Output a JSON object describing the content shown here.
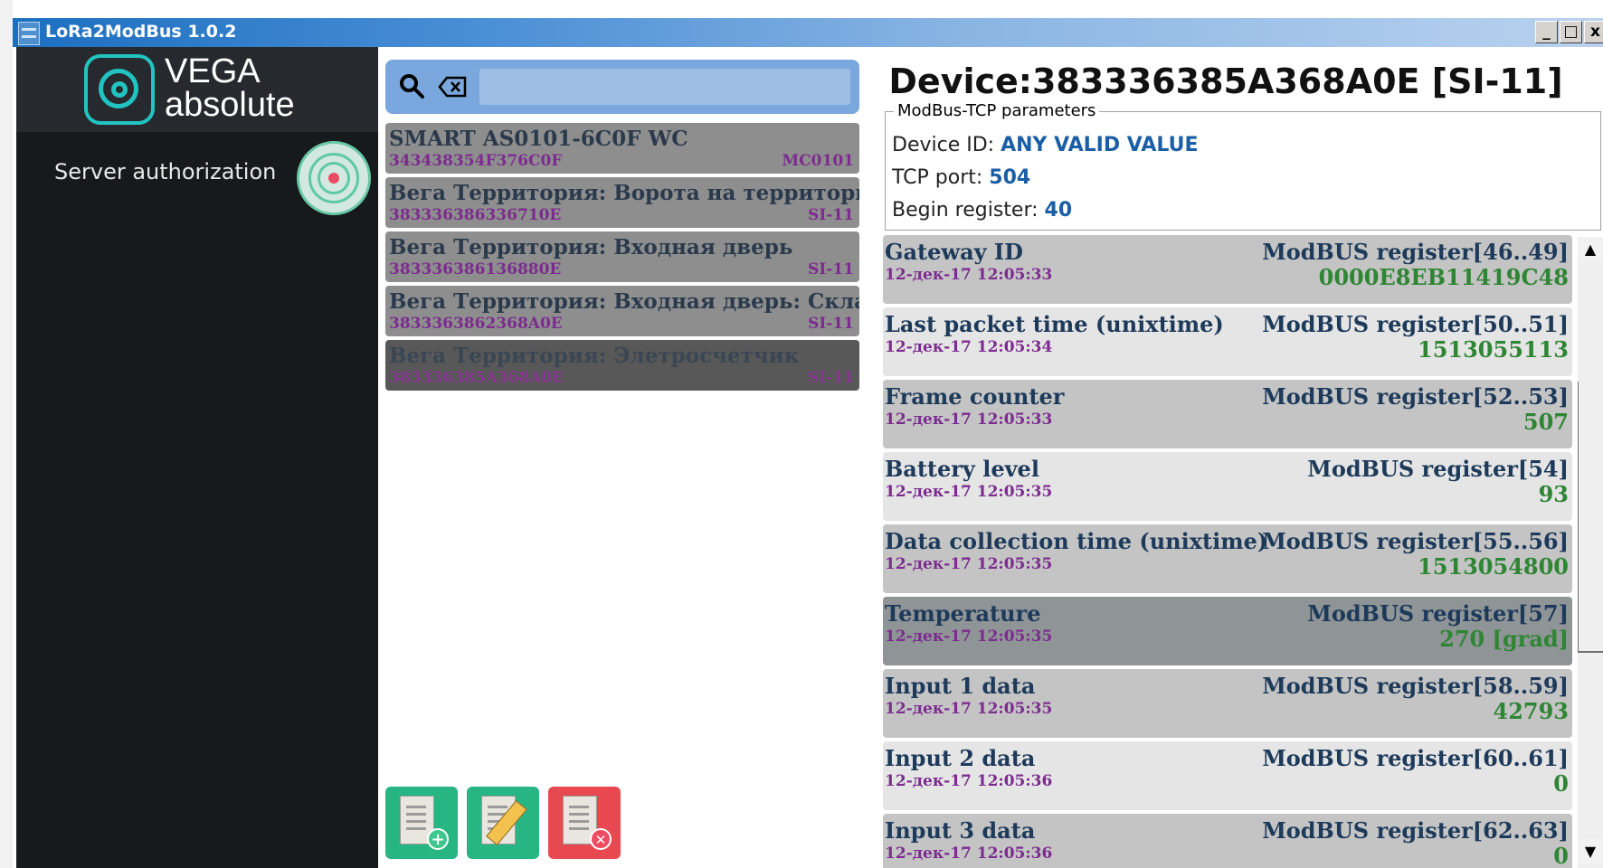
{
  "window": {
    "title": "LoRa2ModBus 1.0.2",
    "minimize": "_",
    "maximize": "□",
    "close": "x"
  },
  "sidebar": {
    "logo_line1": "VEGA",
    "logo_line2": "absolute",
    "items": [
      {
        "label": "Server authorization",
        "icon": "radar-icon"
      }
    ]
  },
  "search": {
    "value": "",
    "placeholder": ""
  },
  "devices": [
    {
      "name": "SMART AS0101-6C0F WC",
      "id": "343438354F376C0F",
      "type": "MC0101"
    },
    {
      "name": "Вега Территория: Ворота на территорию",
      "id": "383336386336710E",
      "type": "SI-11"
    },
    {
      "name": "Вега Территория: Входная дверь",
      "id": "383336386136880E",
      "type": "SI-11"
    },
    {
      "name": "Вега Территория: Входная дверь: Склад",
      "id": "3833363862368A0E",
      "type": "SI-11"
    },
    {
      "name": "Вега Территория: Элетросчетчик",
      "id": "383336385A368A0E",
      "type": "SI-11",
      "selected": true
    }
  ],
  "actions": {
    "add": "add-document-icon",
    "edit": "edit-document-icon",
    "delete": "delete-document-icon"
  },
  "device_panel": {
    "title": "Device:383336385A368A0E [SI-11]",
    "params_legend": "ModBus-TCP parameters",
    "device_id_label": "Device ID:",
    "device_id_value": "ANY VALID VALUE",
    "tcp_port_label": "TCP port:",
    "tcp_port_value": "504",
    "begin_register_label": "Begin register:",
    "begin_register_value": "40"
  },
  "registers": [
    {
      "name": "Gateway ID",
      "time": "12-дек-17 12:05:33",
      "register": "ModBUS register[46..49]",
      "value": "0000E8EB11419C48"
    },
    {
      "name": "Last packet time (unixtime)",
      "time": "12-дек-17 12:05:34",
      "register": "ModBUS register[50..51]",
      "value": "1513055113"
    },
    {
      "name": "Frame counter",
      "time": "12-дек-17 12:05:33",
      "register": "ModBUS register[52..53]",
      "value": "507"
    },
    {
      "name": "Battery level",
      "time": "12-дек-17 12:05:35",
      "register": "ModBUS register[54]",
      "value": "93"
    },
    {
      "name": "Data collection time (unixtime)",
      "time": "12-дек-17 12:05:35",
      "register": "ModBUS register[55..56]",
      "value": "1513054800"
    },
    {
      "name": "Temperature",
      "time": "12-дек-17 12:05:35",
      "register": "ModBUS register[57]",
      "value": "270 [grad]"
    },
    {
      "name": "Input 1 data",
      "time": "12-дек-17 12:05:35",
      "register": "ModBUS register[58..59]",
      "value": "42793"
    },
    {
      "name": "Input 2 data",
      "time": "12-дек-17 12:05:36",
      "register": "ModBUS register[60..61]",
      "value": "0"
    },
    {
      "name": "Input 3 data",
      "time": "12-дек-17 12:05:36",
      "register": "ModBUS register[62..63]",
      "value": "0"
    }
  ],
  "scroll": {
    "up": "▲",
    "down": "▼"
  },
  "colors": {
    "accent": "#22c4c1",
    "value_green": "#2e8534",
    "param_blue": "#1a5ea6",
    "timestamp_purple": "#7c2b8f",
    "delete_red": "#e8484f",
    "add_green": "#27b584"
  }
}
